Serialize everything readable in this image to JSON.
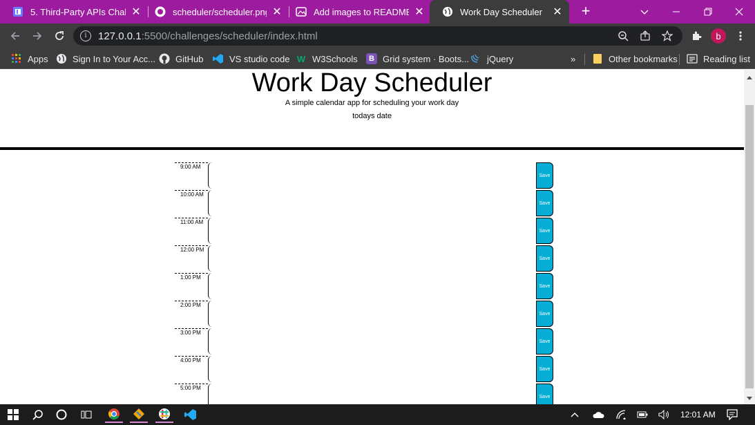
{
  "browser": {
    "tabs": [
      {
        "title": "5. Third-Party APIs Challen",
        "icon": "course-icon",
        "active": false
      },
      {
        "title": "scheduler/scheduler.png a",
        "icon": "github-icon",
        "active": false
      },
      {
        "title": "Add images to README G",
        "icon": "image-icon",
        "active": false
      },
      {
        "title": "Work Day Scheduler",
        "icon": "globe-icon",
        "active": true
      }
    ],
    "address": {
      "host": "127.0.0.1",
      "path": ":5500/challenges/scheduler/index.html"
    },
    "profile_initial": "b",
    "bookmarks": [
      {
        "label": "Apps",
        "icon": "apps-grid-icon"
      },
      {
        "label": "Sign In to Your Acc...",
        "icon": "globe-icon"
      },
      {
        "label": "GitHub",
        "icon": "github-icon"
      },
      {
        "label": "VS studio code",
        "icon": "vscode-icon"
      },
      {
        "label": "W3Schools",
        "icon": "w3schools-icon"
      },
      {
        "label": "Grid system · Boots...",
        "icon": "bootstrap-icon"
      },
      {
        "label": "jQuery",
        "icon": "jquery-icon"
      }
    ],
    "bookmarks_overflow": "»",
    "other_bookmarks": "Other bookmarks",
    "reading_list": "Reading list"
  },
  "page": {
    "title": "Work Day Scheduler",
    "lead": "A simple calendar app for scheduling your work day",
    "current_day": "todays date",
    "save_label": "Save",
    "hours": [
      "9:00 AM",
      "10:00 AM",
      "11:00 AM",
      "12:00 PM",
      "1:00 PM",
      "2:00 PM",
      "3:00 PM",
      "4:00 PM",
      "5:00 PM"
    ]
  },
  "taskbar": {
    "clock": "12:01 AM"
  },
  "colors": {
    "tab_strip": "#9c1b9e",
    "save_button": "#06aed5",
    "profile": "#c2185b"
  }
}
